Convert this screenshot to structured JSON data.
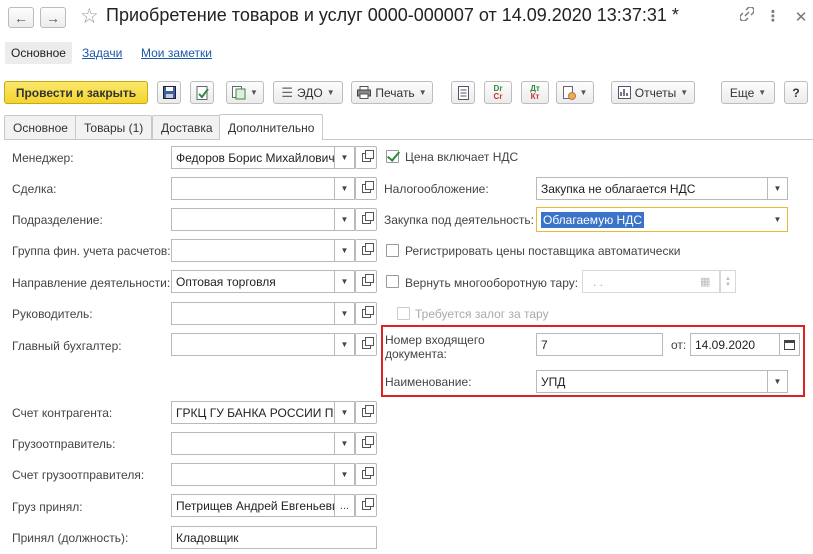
{
  "window": {
    "title": "Приобретение товаров и услуг 0000-000007 от 14.09.2020 13:37:31 *",
    "back_icon": "←",
    "forward_icon": "→",
    "star_icon": "☆",
    "link_icon": "🔗",
    "menu_icon": "⋮",
    "maximize_icon": "▭",
    "close_icon": "✕"
  },
  "secnav": {
    "main": "Основное",
    "tasks": "Задачи",
    "notes": "Мои заметки"
  },
  "toolbar": {
    "post_close": "Провести и закрыть",
    "edo": "ЭДО",
    "print": "Печать",
    "reports": "Отчеты",
    "more": "Еще",
    "help": "?",
    "dt_kt_top": "Dr",
    "dt_kt_bottom": "Cr",
    "dt_top": "Дт",
    "dt_bottom": "Кт"
  },
  "tabs": [
    "Основное",
    "Товары (1)",
    "Доставка",
    "Дополнительно"
  ],
  "left": {
    "manager": {
      "label": "Менеджер:",
      "value": "Федоров Борис Михайлович"
    },
    "deal": {
      "label": "Сделка:",
      "value": ""
    },
    "division": {
      "label": "Подразделение:",
      "value": ""
    },
    "fin_group": {
      "label": "Группа фин. учета расчетов:",
      "value": ""
    },
    "direction": {
      "label": "Направление деятельности:",
      "value": "Оптовая торговля"
    },
    "head": {
      "label": "Руководитель:",
      "value": ""
    },
    "chief_acc": {
      "label": "Главный бухгалтер:",
      "value": ""
    },
    "counter_acc": {
      "label": "Счет контрагента:",
      "value": "ГРКЦ ГУ БАНКА РОССИИ ПО"
    },
    "shipper": {
      "label": "Грузоотправитель:",
      "value": ""
    },
    "shipper_acc": {
      "label": "Счет грузоотправителя:",
      "value": ""
    },
    "received_by": {
      "label": "Груз принял:",
      "value": "Петрищев Андрей Евгеньевич"
    },
    "position": {
      "label": "Принял (должность):",
      "value": "Кладовщик"
    },
    "ellipsis": "..."
  },
  "right": {
    "price_vat": "Цена включает НДС",
    "taxation": {
      "label": "Налогообложение:",
      "value": "Закупка не облагается НДС"
    },
    "purchase_for": {
      "label": "Закупка под деятельность:",
      "value": "Облагаемую НДС"
    },
    "register_prices": "Регистрировать цены поставщика автоматически",
    "return_tare": "Вернуть многооборотную тару:",
    "tare_date": ". .",
    "deposit": "Требуется залог за тару",
    "incoming_no": {
      "label_line1": "Номер входящего",
      "label_line2": "документа:",
      "value": "7"
    },
    "from": {
      "label": "от:",
      "value": "14.09.2020"
    },
    "name": {
      "label": "Наименование:",
      "value": "УПД"
    }
  },
  "colors": {
    "primary_button": "#f4d42e",
    "link": "#1a59a8",
    "highlight": "#d22222",
    "selection": "#3b73c8",
    "focus_border": "#e8b83a"
  }
}
